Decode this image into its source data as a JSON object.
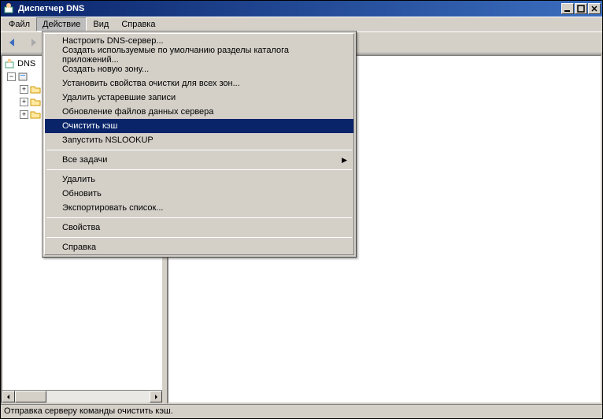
{
  "title": "Диспетчер DNS",
  "menus": {
    "file": "Файл",
    "action": "Действие",
    "view": "Вид",
    "help": "Справка"
  },
  "tree": {
    "root": "DNS",
    "node1_prefix": "",
    "sub1": "",
    "sub2": "",
    "sub3": ""
  },
  "dropdown": {
    "i0": "Настроить DNS-сервер...",
    "i1": "Создать используемые по умолчанию разделы каталога приложений...",
    "i2": "Создать новую зону...",
    "i3": "Установить свойства очистки для всех зон...",
    "i4": "Удалить устаревшие записи",
    "i5": "Обновление файлов данных сервера",
    "i6": "Очистить кэш",
    "i7": "Запустить NSLOOKUP",
    "i8": "Все задачи",
    "i9": "Удалить",
    "i10": "Обновить",
    "i11": "Экспортировать список...",
    "i12": "Свойства",
    "i13": "Справка"
  },
  "status": "Отправка серверу команды очистить кэш."
}
